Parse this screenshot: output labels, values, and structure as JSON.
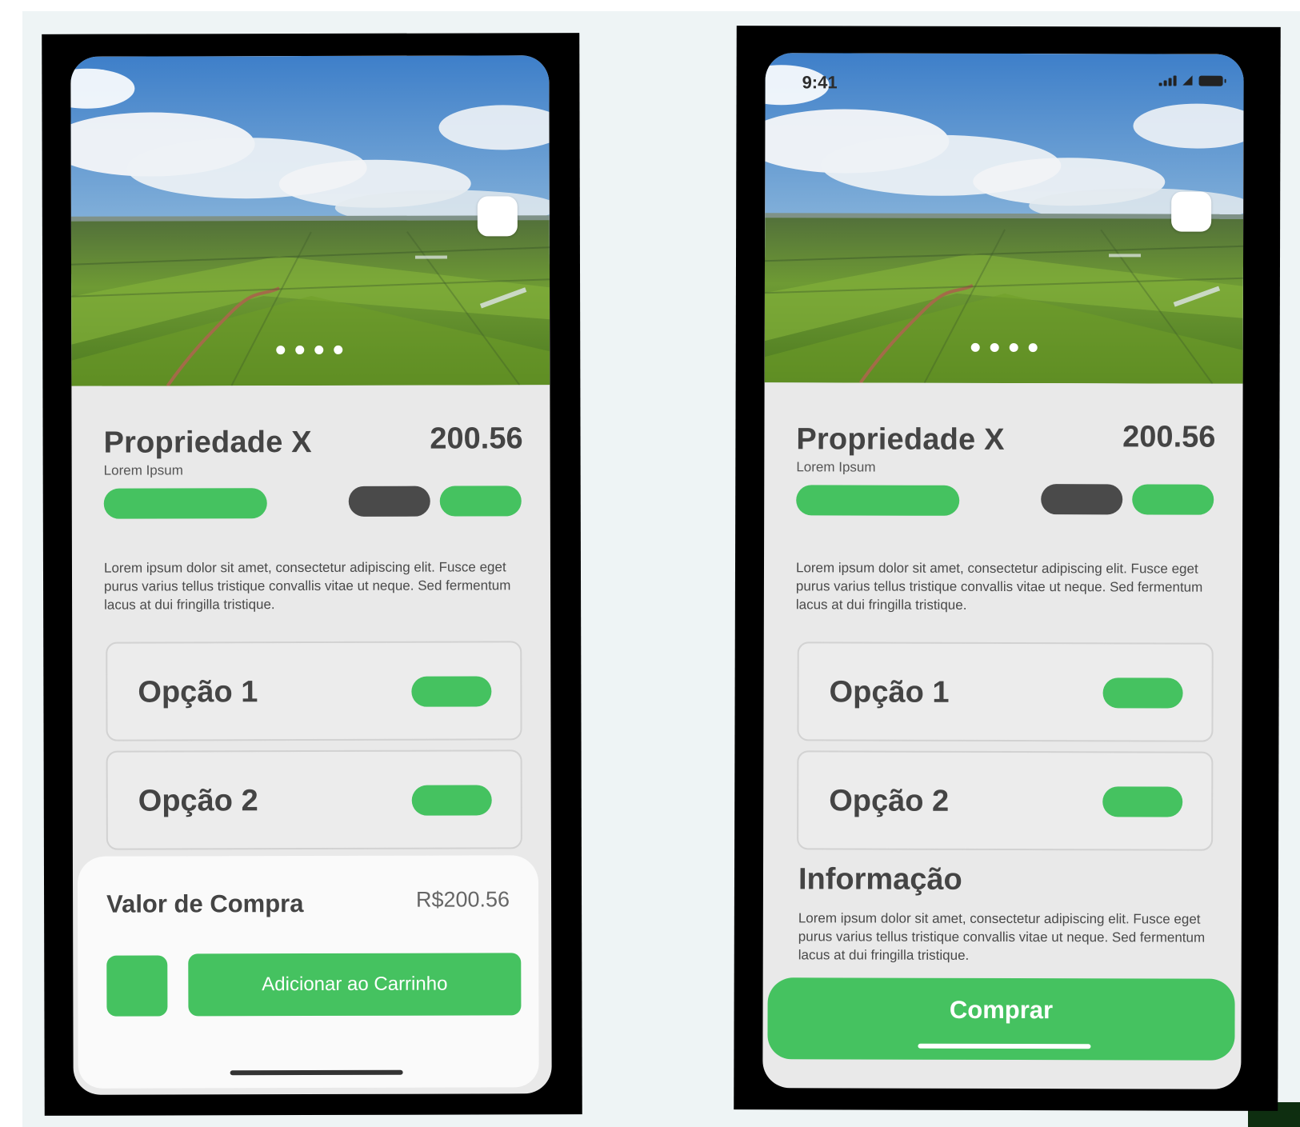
{
  "screens": {
    "cart": {
      "property": {
        "title": "Propriedade X",
        "subtitle": "Lorem Ipsum",
        "price": "200.56",
        "description": "Lorem ipsum dolor sit amet, consectetur adipiscing elit. Fusce eget purus varius tellus tristique convallis vitae ut neque. Sed fermentum lacus at dui fringilla tristique."
      },
      "options": [
        "Opção 1",
        "Opção 2"
      ],
      "purchase": {
        "label": "Valor de Compra",
        "value": "R$200.56",
        "add_to_cart_label": "Adicionar ao Carrinho"
      }
    },
    "buy": {
      "status_bar": {
        "time": "9:41",
        "icons": [
          "signal-icon",
          "wifi-icon",
          "battery-icon"
        ]
      },
      "property": {
        "title": "Propriedade X",
        "subtitle": "Lorem Ipsum",
        "price": "200.56",
        "description": "Lorem ipsum dolor sit amet, consectetur adipiscing elit. Fusce eget purus varius tellus tristique convallis vitae ut neque. Sed fermentum lacus at dui fringilla tristique."
      },
      "options": [
        "Opção 1",
        "Opção 2"
      ],
      "info": {
        "heading": "Informação",
        "text": "Lorem ipsum dolor sit amet, consectetur adipiscing elit. Fusce eget purus varius tellus tristique convallis vitae ut neque. Sed fermentum lacus at dui fringilla tristique."
      },
      "buy_label": "Comprar"
    }
  },
  "carousel": {
    "total_pages": 4
  },
  "colors": {
    "accent": "#45c260",
    "dark_pill": "#4a4a4a",
    "text": "#444444",
    "frame": "#000000",
    "background": "#eef4f5"
  }
}
